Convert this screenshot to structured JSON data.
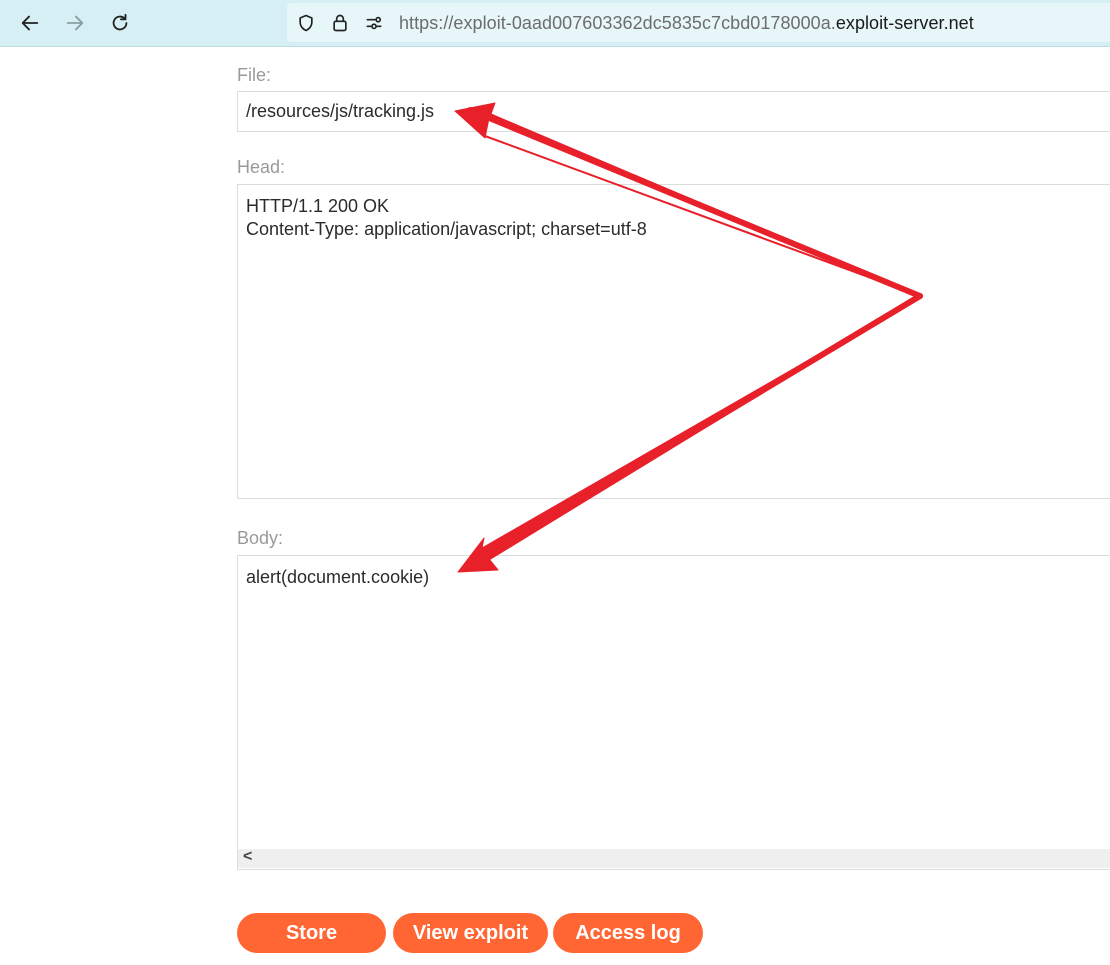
{
  "browser": {
    "url_prefix": "https://exploit-0aad007603362dc5835c7cbd0178000a.",
    "url_domain": "exploit-server.net",
    "icons": [
      "back-arrow-icon",
      "forward-arrow-icon",
      "reload-icon",
      "shield-icon",
      "lock-icon",
      "permissions-icon"
    ]
  },
  "form": {
    "file_label": "File:",
    "file_value": "/resources/js/tracking.js",
    "head_label": "Head:",
    "head_value": "HTTP/1.1 200 OK\nContent-Type: application/javascript; charset=utf-8",
    "body_label": "Body:",
    "body_value": "alert(document.cookie)",
    "scroll_left_glyph": "<"
  },
  "buttons": {
    "store": "Store",
    "view_exploit": "View exploit",
    "access_log": "Access log"
  },
  "colors": {
    "accent": "#ff6633",
    "annotation_arrow": "#e8202a",
    "toolbar_bg": "#d5eff4"
  }
}
